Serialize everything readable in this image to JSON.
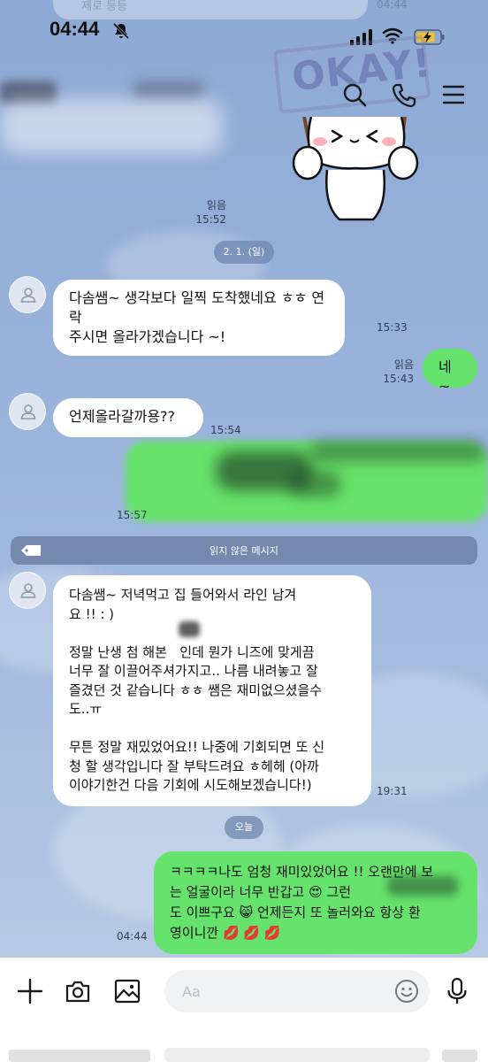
{
  "status_bar": {
    "time": "04:44",
    "top_ghost_text": "제로 등등",
    "top_ghost_time": "04:44"
  },
  "header": {
    "sticker_sign_text": "OKAY!",
    "icons": {
      "search": "search-icon",
      "call": "phone-icon",
      "menu": "menu-icon"
    }
  },
  "messages": [
    {
      "id": "m0",
      "direction": "out",
      "type": "sticker",
      "read": "읽음",
      "time": "15:52"
    },
    {
      "id": "d1",
      "type": "date",
      "text": "2. 1. (일)"
    },
    {
      "id": "m1",
      "direction": "in",
      "text": "다솜쌤~ 생각보다 일찍 도착했네요 ㅎㅎ 연락\n주시면 올라가겠습니다 ~!",
      "time": "15:33"
    },
    {
      "id": "m2",
      "direction": "out",
      "text": "네~",
      "read": "읽음",
      "time": "15:43"
    },
    {
      "id": "m3",
      "direction": "in",
      "text": "언제올라갈까용??",
      "time": "15:54"
    },
    {
      "id": "m4",
      "direction": "out",
      "type": "redacted",
      "time": "15:57"
    },
    {
      "id": "unread",
      "type": "unread_divider",
      "text": "읽지 않은 메시지"
    },
    {
      "id": "m5",
      "direction": "in",
      "text": "다솜쌤~ 저녁먹고 집 들어와서 라인 남겨\n요 !! : )\n\n정말 난생 첨 해본   인데 뭔가 니즈에 맞게끔\n너무 잘 이끌어주셔가지고.. 나름 내려놓고 잘\n즐겼던 것 같습니다 ㅎㅎ 쌤은 재미없으셨을수\n도..ㅠ\n\n무튼 정말 재밌었어요!! 나중에 기회되면 또 신\n청 할 생각입니다 잘 부탁드려요 ㅎ헤헤 (아까\n이야기한건 다음 기회에 시도해보겠습니다!)",
      "time": "19:31"
    },
    {
      "id": "d2",
      "type": "date",
      "text": "오늘"
    },
    {
      "id": "m6",
      "direction": "out",
      "text": "ㅋㅋㅋㅋ나도 엄청 재미있었어요 !! 오랜만에 보\n는 얼굴이라 너무 반갑고 😍 그런\n도 이쁘구요 😸 언제든지 또 놀러와요 항상 환\n영이니깐 💋 💋 💋",
      "time": "04:44"
    }
  ],
  "input_bar": {
    "placeholder": "Aa",
    "icons": [
      "plus-icon",
      "camera-icon",
      "gallery-icon",
      "emoji-icon",
      "mic-icon"
    ]
  },
  "colors": {
    "chat_background": "#98b2db",
    "outgoing_bubble": "#66e36c",
    "incoming_bubble": "#ffffff",
    "date_chip": "#6e87af"
  }
}
